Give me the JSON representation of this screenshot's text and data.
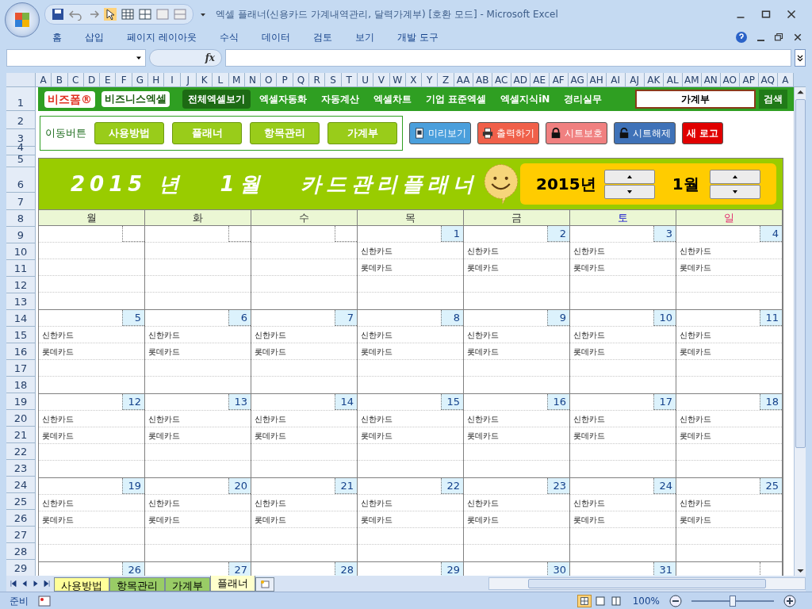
{
  "window": {
    "title": "엑셀 플래너(신용카드 가계내역관리, 달력가계부)  [호환 모드] - Microsoft Excel"
  },
  "ribbon_tabs": [
    "홈",
    "삽입",
    "페이지 레이아웃",
    "수식",
    "데이터",
    "검토",
    "보기",
    "개발 도구"
  ],
  "formula_bar": {
    "fx": "fx"
  },
  "column_headers": [
    "A",
    "B",
    "C",
    "D",
    "E",
    "F",
    "G",
    "H",
    "I",
    "J",
    "K",
    "L",
    "M",
    "N",
    "O",
    "P",
    "Q",
    "R",
    "S",
    "T",
    "U",
    "V",
    "W",
    "X",
    "Y",
    "Z",
    "AA",
    "AB",
    "AC",
    "AD",
    "AE",
    "AF",
    "AG",
    "AH",
    "AI",
    "AJ",
    "AK",
    "AL",
    "AM",
    "AN",
    "AO",
    "AP",
    "AQ",
    "A"
  ],
  "row_numbers": [
    "1",
    "2",
    "3",
    "4",
    "5",
    "6",
    "7",
    "8",
    "9",
    "10",
    "11",
    "12",
    "13",
    "14",
    "15",
    "16",
    "17",
    "18",
    "19",
    "20",
    "21",
    "22",
    "23",
    "24",
    "25",
    "26",
    "27",
    "28",
    "29"
  ],
  "nav_bar": {
    "logo": "비즈폼®",
    "logo2": "비즈니스엑셀",
    "items": [
      {
        "label": "전체엑셀보기",
        "selected": true
      },
      {
        "label": "엑셀자동화",
        "selected": false
      },
      {
        "label": "자동계산",
        "selected": false
      },
      {
        "label": "엑셀차트",
        "selected": false
      },
      {
        "label": "기업 표준엑셀",
        "selected": false
      },
      {
        "label": "엑셀지식iN",
        "selected": false
      },
      {
        "label": "경리실무",
        "selected": false
      }
    ],
    "search_value": "가계부",
    "search_button": "검색"
  },
  "move_buttons": {
    "label": "이동버튼",
    "buttons": [
      "사용방법",
      "플래너",
      "항목관리",
      "가계부"
    ]
  },
  "action_buttons": [
    {
      "label": "미리보기",
      "color": "#4a9fdc",
      "kind": "preview"
    },
    {
      "label": "출력하기",
      "color": "#f0604a",
      "kind": "print"
    },
    {
      "label": "시트보호",
      "color": "#f08080",
      "kind": "lock"
    },
    {
      "label": "시트해제",
      "color": "#3f72b8",
      "kind": "unlock"
    },
    {
      "label": "새 로고",
      "color": "#e00000",
      "kind": "plain"
    }
  ],
  "calendar": {
    "title": "2015 년   1월   카드관리플래너",
    "year": "2015년",
    "month": "1월",
    "weekdays": [
      {
        "label": "월",
        "kind": "weekday"
      },
      {
        "label": "화",
        "kind": "weekday"
      },
      {
        "label": "수",
        "kind": "weekday"
      },
      {
        "label": "목",
        "kind": "weekday"
      },
      {
        "label": "금",
        "kind": "weekday"
      },
      {
        "label": "토",
        "kind": "saturday"
      },
      {
        "label": "일",
        "kind": "sunday"
      }
    ],
    "weeks": [
      [
        {
          "kind": "blank"
        },
        {
          "kind": "blank"
        },
        {
          "kind": "blank"
        },
        {
          "day": "1",
          "entries": [
            "신한카드",
            "롯데카드"
          ]
        },
        {
          "day": "2",
          "entries": [
            "신한카드",
            "롯데카드"
          ]
        },
        {
          "day": "3",
          "entries": [
            "신한카드",
            "롯데카드"
          ]
        },
        {
          "day": "4",
          "entries": [
            "신한카드",
            "롯데카드"
          ]
        }
      ],
      [
        {
          "day": "5",
          "entries": [
            "신한카드",
            "롯데카드"
          ]
        },
        {
          "day": "6",
          "entries": [
            "신한카드",
            "롯데카드"
          ]
        },
        {
          "day": "7",
          "entries": [
            "신한카드",
            "롯데카드"
          ]
        },
        {
          "day": "8",
          "entries": [
            "신한카드",
            "롯데카드"
          ]
        },
        {
          "day": "9",
          "entries": [
            "신한카드",
            "롯데카드"
          ]
        },
        {
          "day": "10",
          "entries": [
            "신한카드",
            "롯데카드"
          ]
        },
        {
          "day": "11",
          "entries": [
            "신한카드",
            "롯데카드"
          ]
        }
      ],
      [
        {
          "day": "12",
          "entries": [
            "신한카드",
            "롯데카드"
          ]
        },
        {
          "day": "13",
          "entries": [
            "신한카드",
            "롯데카드"
          ]
        },
        {
          "day": "14",
          "entries": [
            "신한카드",
            "롯데카드"
          ]
        },
        {
          "day": "15",
          "entries": [
            "신한카드",
            "롯데카드"
          ]
        },
        {
          "day": "16",
          "entries": [
            "신한카드",
            "롯데카드"
          ]
        },
        {
          "day": "17",
          "entries": [
            "신한카드",
            "롯데카드"
          ]
        },
        {
          "day": "18",
          "entries": [
            "신한카드",
            "롯데카드"
          ]
        }
      ],
      [
        {
          "day": "19",
          "entries": [
            "신한카드",
            "롯데카드"
          ]
        },
        {
          "day": "20",
          "entries": [
            "신한카드",
            "롯데카드"
          ]
        },
        {
          "day": "21",
          "entries": [
            "신한카드",
            "롯데카드"
          ]
        },
        {
          "day": "22",
          "entries": [
            "신한카드",
            "롯데카드"
          ]
        },
        {
          "day": "23",
          "entries": [
            "신한카드",
            "롯데카드"
          ]
        },
        {
          "day": "24",
          "entries": [
            "신한카드",
            "롯데카드"
          ]
        },
        {
          "day": "25",
          "entries": [
            "신한카드",
            "롯데카드"
          ]
        }
      ],
      [
        {
          "day": "26"
        },
        {
          "day": "27"
        },
        {
          "day": "28"
        },
        {
          "day": "29"
        },
        {
          "day": "30"
        },
        {
          "day": "31"
        },
        {
          "kind": "blank"
        }
      ]
    ]
  },
  "sheet_tabs": [
    {
      "label": "사용방법",
      "color": "#ffff99",
      "selected": false
    },
    {
      "label": "항목관리",
      "color": "#99cc66",
      "selected": false
    },
    {
      "label": "가계부",
      "color": "#99cc66",
      "selected": false
    },
    {
      "label": "플래너",
      "color": "#ffffcc",
      "selected": true
    }
  ],
  "status_bar": {
    "status": "준비",
    "zoom_label": "100%",
    "zoom": {
      "level": 0.5
    }
  }
}
